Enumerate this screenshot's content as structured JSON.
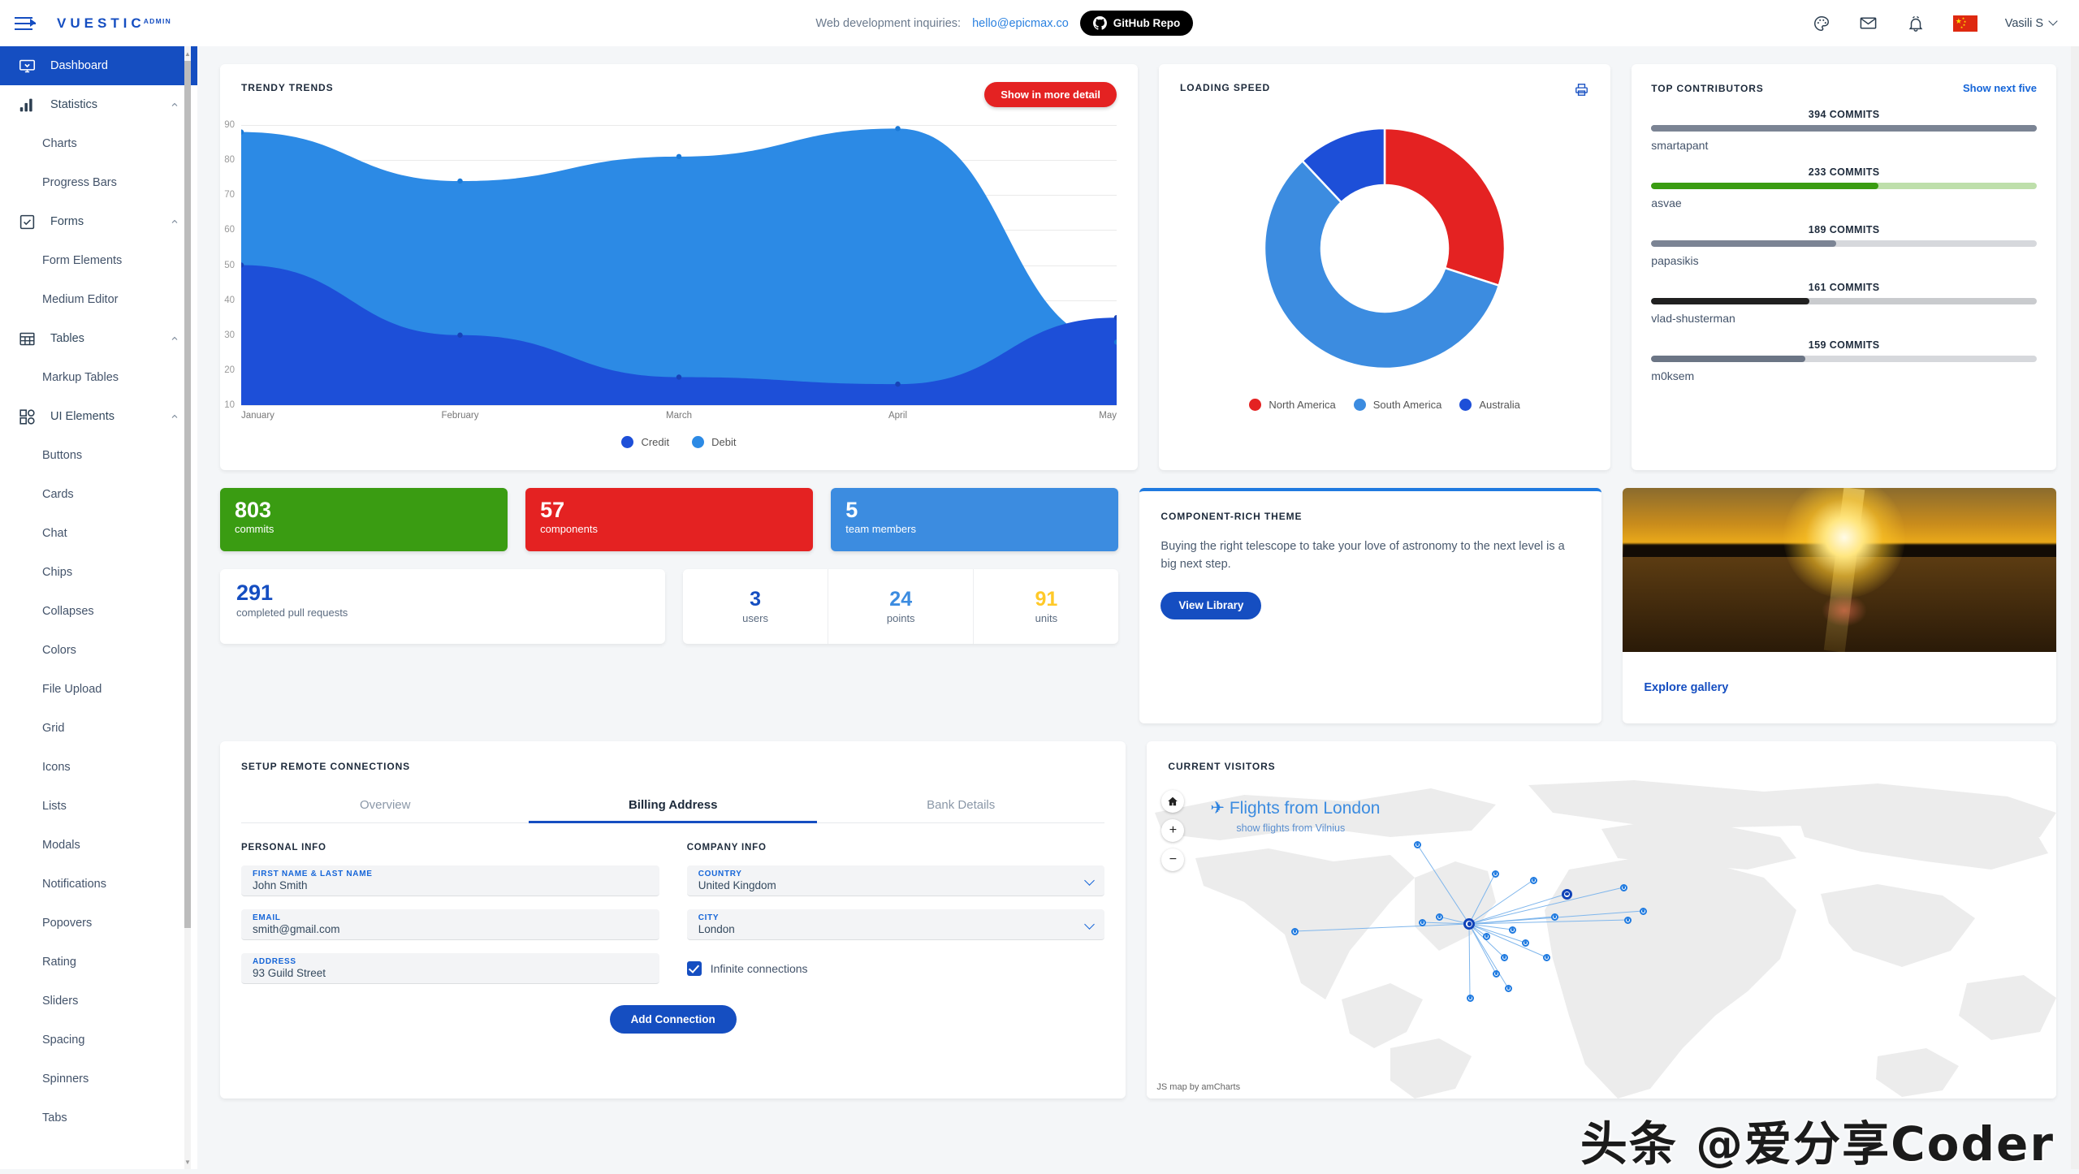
{
  "header": {
    "logo_main": "VUESTIC",
    "logo_sub": "ADMIN",
    "inquiries_label": "Web development inquiries:",
    "inquiries_email": "hello@epicmax.co",
    "github_button": "GitHub Repo",
    "icons": [
      "palette-icon",
      "mail-icon",
      "bell-icon"
    ],
    "language_flag": "china-flag",
    "user_name": "Vasili S"
  },
  "sidebar": {
    "items": [
      {
        "label": "Dashboard",
        "icon": "dashboard-icon",
        "active": true,
        "type": "item"
      },
      {
        "label": "Statistics",
        "icon": "bar-chart-icon",
        "type": "group",
        "expanded": true
      },
      {
        "label": "Charts",
        "type": "child"
      },
      {
        "label": "Progress Bars",
        "type": "child"
      },
      {
        "label": "Forms",
        "icon": "form-check-icon",
        "type": "group",
        "expanded": true
      },
      {
        "label": "Form Elements",
        "type": "child"
      },
      {
        "label": "Medium Editor",
        "type": "child"
      },
      {
        "label": "Tables",
        "icon": "table-icon",
        "type": "group",
        "expanded": true
      },
      {
        "label": "Markup Tables",
        "type": "child"
      },
      {
        "label": "UI Elements",
        "icon": "ui-grid-icon",
        "type": "group",
        "expanded": true
      },
      {
        "label": "Buttons",
        "type": "child"
      },
      {
        "label": "Cards",
        "type": "child"
      },
      {
        "label": "Chat",
        "type": "child"
      },
      {
        "label": "Chips",
        "type": "child"
      },
      {
        "label": "Collapses",
        "type": "child"
      },
      {
        "label": "Colors",
        "type": "child"
      },
      {
        "label": "File Upload",
        "type": "child"
      },
      {
        "label": "Grid",
        "type": "child"
      },
      {
        "label": "Icons",
        "type": "child"
      },
      {
        "label": "Lists",
        "type": "child"
      },
      {
        "label": "Modals",
        "type": "child"
      },
      {
        "label": "Notifications",
        "type": "child"
      },
      {
        "label": "Popovers",
        "type": "child"
      },
      {
        "label": "Rating",
        "type": "child"
      },
      {
        "label": "Sliders",
        "type": "child"
      },
      {
        "label": "Spacing",
        "type": "child"
      },
      {
        "label": "Spinners",
        "type": "child"
      },
      {
        "label": "Tabs",
        "type": "child"
      }
    ]
  },
  "trendy": {
    "title": "Trendy Trends",
    "detail_button": "Show in more detail"
  },
  "loading_speed": {
    "title": "Loading Speed",
    "print_icon": "printer-icon"
  },
  "contributors": {
    "title": "Top Contributors",
    "show_next": "Show next five",
    "rows": [
      {
        "count": "394 COMMITS",
        "name": "smartapant",
        "pct": 100,
        "fill": "#7b8494",
        "track": "#7b8494"
      },
      {
        "count": "233 COMMITS",
        "name": "asvae",
        "pct": 59,
        "fill": "#3a9c12",
        "track": "#bedfab"
      },
      {
        "count": "189 COMMITS",
        "name": "papasikis",
        "pct": 48,
        "fill": "#7b8494",
        "track": "#d6d8dc"
      },
      {
        "count": "161 COMMITS",
        "name": "vlad-shusterman",
        "pct": 41,
        "fill": "#202020",
        "track": "#c9cbce"
      },
      {
        "count": "159 COMMITS",
        "name": "m0ksem",
        "pct": 40,
        "fill": "#6b7585",
        "track": "#d6d8dc"
      }
    ]
  },
  "tiles": [
    {
      "num": "803",
      "label": "commits",
      "color": "#3a9c12"
    },
    {
      "num": "57",
      "label": "components",
      "color": "#e42222"
    },
    {
      "num": "5",
      "label": "team members",
      "color": "#3c8ce0"
    }
  ],
  "tiles2": {
    "pull_requests": {
      "num": "291",
      "label": "completed pull requests",
      "color": "#154ec1"
    },
    "cells": [
      {
        "num": "3",
        "label": "users",
        "color": "#154ec1"
      },
      {
        "num": "24",
        "label": "points",
        "color": "#3c8ce0"
      },
      {
        "num": "91",
        "label": "units",
        "color": "#ffc928"
      }
    ]
  },
  "component_theme": {
    "title": "Component-rich Theme",
    "body": "Buying the right telescope to take your love of astronomy to the next level is a big next step.",
    "button": "View Library"
  },
  "gallery": {
    "link": "Explore gallery",
    "image_alt": "sunset-over-field-photo"
  },
  "setup": {
    "title": "Setup remote connections",
    "tabs": [
      {
        "label": "Overview",
        "active": false
      },
      {
        "label": "Billing Address",
        "active": true
      },
      {
        "label": "Bank Details",
        "active": false
      }
    ],
    "personal_head": "Personal Info",
    "company_head": "Company Info",
    "fields": {
      "name": {
        "label": "First Name & Last Name",
        "value": "John Smith"
      },
      "email": {
        "label": "Email",
        "value": "smith@gmail.com"
      },
      "address": {
        "label": "Address",
        "value": "93  Guild Street"
      },
      "country": {
        "label": "Country",
        "value": "United Kingdom"
      },
      "city": {
        "label": "City",
        "value": "London"
      }
    },
    "checkbox": {
      "label": "Infinite connections",
      "checked": true
    },
    "submit": "Add Connection"
  },
  "visitors": {
    "title": "Current Visitors",
    "flight_title": "Flights from London",
    "flight_sub": "show flights from Vilnius",
    "attribution": "JS map by amCharts",
    "controls": {
      "home": "home-icon",
      "zoom_in": "+",
      "zoom_out": "−"
    }
  },
  "watermark": "头条 @爱分享Coder",
  "chart_data": [
    {
      "type": "area",
      "title": "Trendy Trends",
      "categories": [
        "January",
        "February",
        "March",
        "April",
        "May"
      ],
      "series": [
        {
          "name": "Debit",
          "values": [
            88,
            74,
            81,
            89,
            28
          ],
          "color": "#2c8ae5"
        },
        {
          "name": "Credit",
          "values": [
            50,
            30,
            18,
            16,
            35
          ],
          "color": "#1d4fd8"
        }
      ],
      "ylim": [
        10,
        90
      ],
      "yticks": [
        10,
        20,
        30,
        40,
        50,
        60,
        70,
        80,
        90
      ],
      "xlabel": "",
      "ylabel": "",
      "grid": true,
      "legend_position": "bottom"
    },
    {
      "type": "pie",
      "title": "Loading Speed",
      "donut": true,
      "labels": [
        "North America",
        "South America",
        "Australia"
      ],
      "values": [
        30,
        58,
        12
      ],
      "colors": [
        "#e42222",
        "#3c8ce0",
        "#1d4fd8"
      ],
      "legend_position": "bottom"
    },
    {
      "type": "bar",
      "title": "Top Contributors",
      "categories": [
        "smartapant",
        "asvae",
        "papasikis",
        "vlad-shusterman",
        "m0ksem"
      ],
      "values": [
        394,
        233,
        189,
        161,
        159
      ],
      "ylabel": "COMMITS",
      "xlabel": ""
    }
  ]
}
